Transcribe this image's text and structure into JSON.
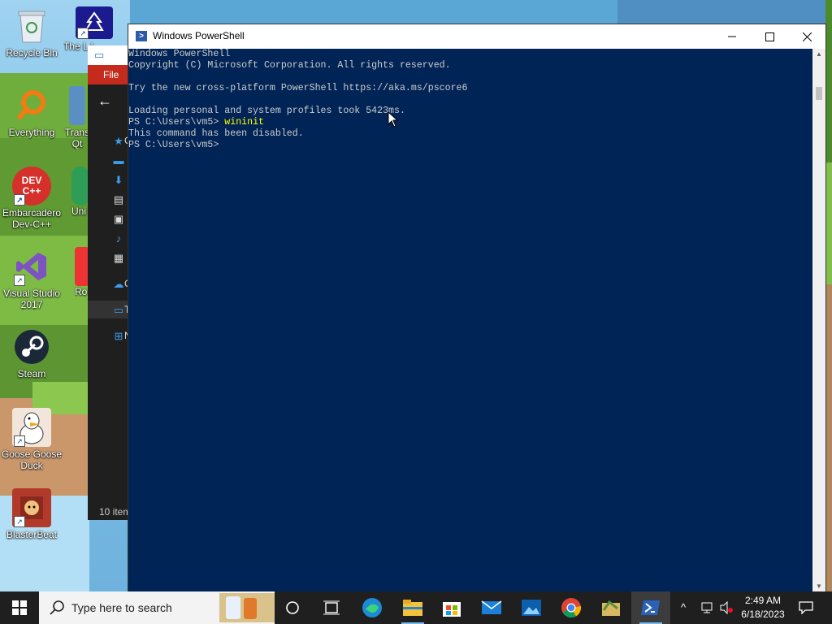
{
  "desktop": {
    "icons": [
      {
        "label": "Recycle Bin",
        "icon": "recycle-bin-icon"
      },
      {
        "label": "The L Leak",
        "icon": "tree-app-icon"
      },
      {
        "label": "Everything",
        "icon": "everything-search-icon"
      },
      {
        "label": "Trans Qt",
        "icon": "qt-app-icon"
      },
      {
        "label": "Embarcadero Dev-C++",
        "icon": "devcpp-icon",
        "badge": "DEV C++"
      },
      {
        "label": "Uni",
        "icon": "unity-icon"
      },
      {
        "label": "Visual Studio 2017",
        "icon": "visual-studio-icon"
      },
      {
        "label": "Ro",
        "icon": "red-app-icon"
      },
      {
        "label": "Steam",
        "icon": "steam-icon"
      },
      {
        "label": "Goose Goose Duck",
        "icon": "goose-icon"
      },
      {
        "label": "BlasterBeat",
        "icon": "blasterbeat-icon"
      }
    ]
  },
  "explorer": {
    "file_tab": "File",
    "nav_letters": [
      "C",
      "C",
      "T",
      "N"
    ],
    "status": "10 item"
  },
  "powershell": {
    "title": "Windows PowerShell",
    "lines": [
      {
        "text": "Windows PowerShell"
      },
      {
        "text": "Copyright (C) Microsoft Corporation. All rights reserved."
      },
      {
        "text": ""
      },
      {
        "text": "Try the new cross-platform PowerShell https://aka.ms/pscore6"
      },
      {
        "text": ""
      },
      {
        "text": "Loading personal and system profiles took 5423ms."
      },
      {
        "prompt": "PS C:\\Users\\vm5> ",
        "command": "wininit"
      },
      {
        "text": "This command has been disabled."
      },
      {
        "prompt": "PS C:\\Users\\vm5> ",
        "command": ""
      }
    ],
    "colors": {
      "background": "#012456",
      "text": "#cccccc",
      "command": "#ffff00"
    }
  },
  "taskbar": {
    "search_placeholder": "Type here to search",
    "time": "2:49 AM",
    "date": "6/18/2023",
    "pinned": [
      "cortana-icon",
      "task-view-icon",
      "edge-icon",
      "file-explorer-icon",
      "store-icon",
      "mail-icon",
      "photos-icon",
      "chrome-icon",
      "app-icon",
      "powershell-icon"
    ]
  }
}
